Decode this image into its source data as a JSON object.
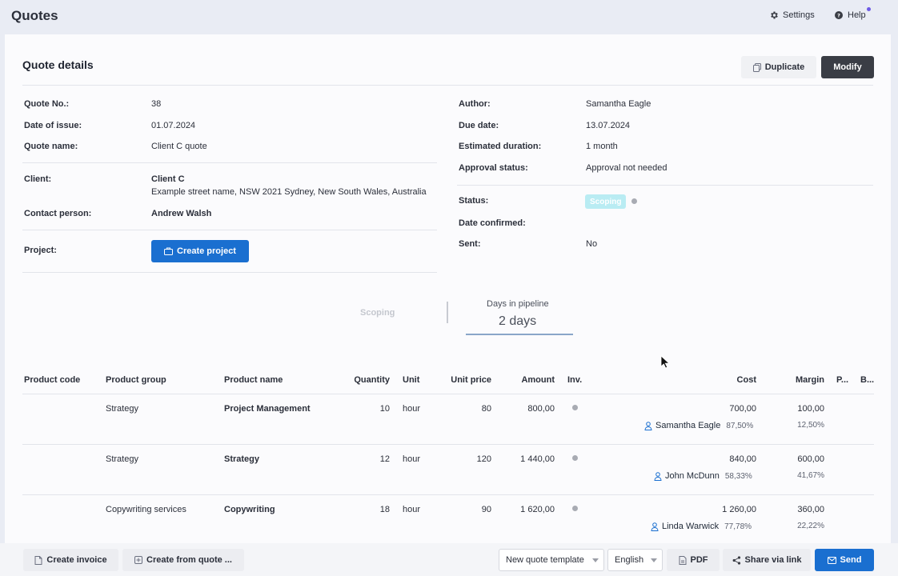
{
  "app": {
    "title": "Quotes",
    "settings_label": "Settings",
    "help_label": "Help"
  },
  "header": {
    "title": "Quote details",
    "duplicate_label": "Duplicate",
    "modify_label": "Modify"
  },
  "left": {
    "quote_no": {
      "label": "Quote No.:",
      "value": "38"
    },
    "date_of_issue": {
      "label": "Date of issue:",
      "value": "01.07.2024"
    },
    "quote_name": {
      "label": "Quote name:",
      "value": "Client C quote"
    },
    "client": {
      "label": "Client:",
      "name": "Client C",
      "address": "Example street name, NSW 2021 Sydney, New South Wales, Australia"
    },
    "contact": {
      "label": "Contact person:",
      "value": "Andrew Walsh"
    },
    "project": {
      "label": "Project:",
      "button_label": "Create project"
    }
  },
  "right": {
    "author": {
      "label": "Author:",
      "value": "Samantha Eagle"
    },
    "due_date": {
      "label": "Due date:",
      "value": "13.07.2024"
    },
    "duration": {
      "label": "Estimated duration:",
      "value": "1 month"
    },
    "approval": {
      "label": "Approval status:",
      "value": "Approval not needed"
    },
    "status": {
      "label": "Status:",
      "badge": "Scoping"
    },
    "date_confirmed": {
      "label": "Date confirmed:",
      "value": ""
    },
    "sent": {
      "label": "Sent:",
      "value": "No"
    }
  },
  "pipeline": {
    "stage": "Scoping",
    "title": "Days in pipeline",
    "days": "2 days"
  },
  "table": {
    "headers": {
      "product_code": "Product code",
      "product_group": "Product group",
      "product_name": "Product name",
      "quantity": "Quantity",
      "unit": "Unit",
      "unit_price": "Unit price",
      "amount": "Amount",
      "inv": "Inv.",
      "cost": "Cost",
      "margin": "Margin",
      "p": "P...",
      "b": "B..."
    },
    "rows": [
      {
        "group": "Strategy",
        "name": "Project Management",
        "quantity": "10",
        "unit": "hour",
        "unit_price": "80",
        "amount": "800,00",
        "cost": "700,00",
        "margin": "100,00",
        "person": "Samantha Eagle",
        "cost_pct": "87,50%",
        "margin_pct": "12,50%"
      },
      {
        "group": "Strategy",
        "name": "Strategy",
        "quantity": "12",
        "unit": "hour",
        "unit_price": "120",
        "amount": "1 440,00",
        "cost": "840,00",
        "margin": "600,00",
        "person": "John McDunn",
        "cost_pct": "58,33%",
        "margin_pct": "41,67%"
      },
      {
        "group": "Copywriting services",
        "name": "Copywriting",
        "quantity": "18",
        "unit": "hour",
        "unit_price": "90",
        "amount": "1 620,00",
        "cost": "1 260,00",
        "margin": "360,00",
        "person": "Linda Warwick",
        "cost_pct": "77,78%",
        "margin_pct": "22,22%"
      }
    ]
  },
  "footer": {
    "create_invoice": "Create invoice",
    "create_from_quote": "Create from quote ...",
    "template_select": "New quote template",
    "language_select": "English",
    "pdf": "PDF",
    "share": "Share via link",
    "send": "Send"
  },
  "colors": {
    "primary": "#1a6fd0",
    "dark_button": "#3a3d45",
    "badge_bg": "#b9ecf3",
    "page_bg": "#e9ecf4"
  }
}
